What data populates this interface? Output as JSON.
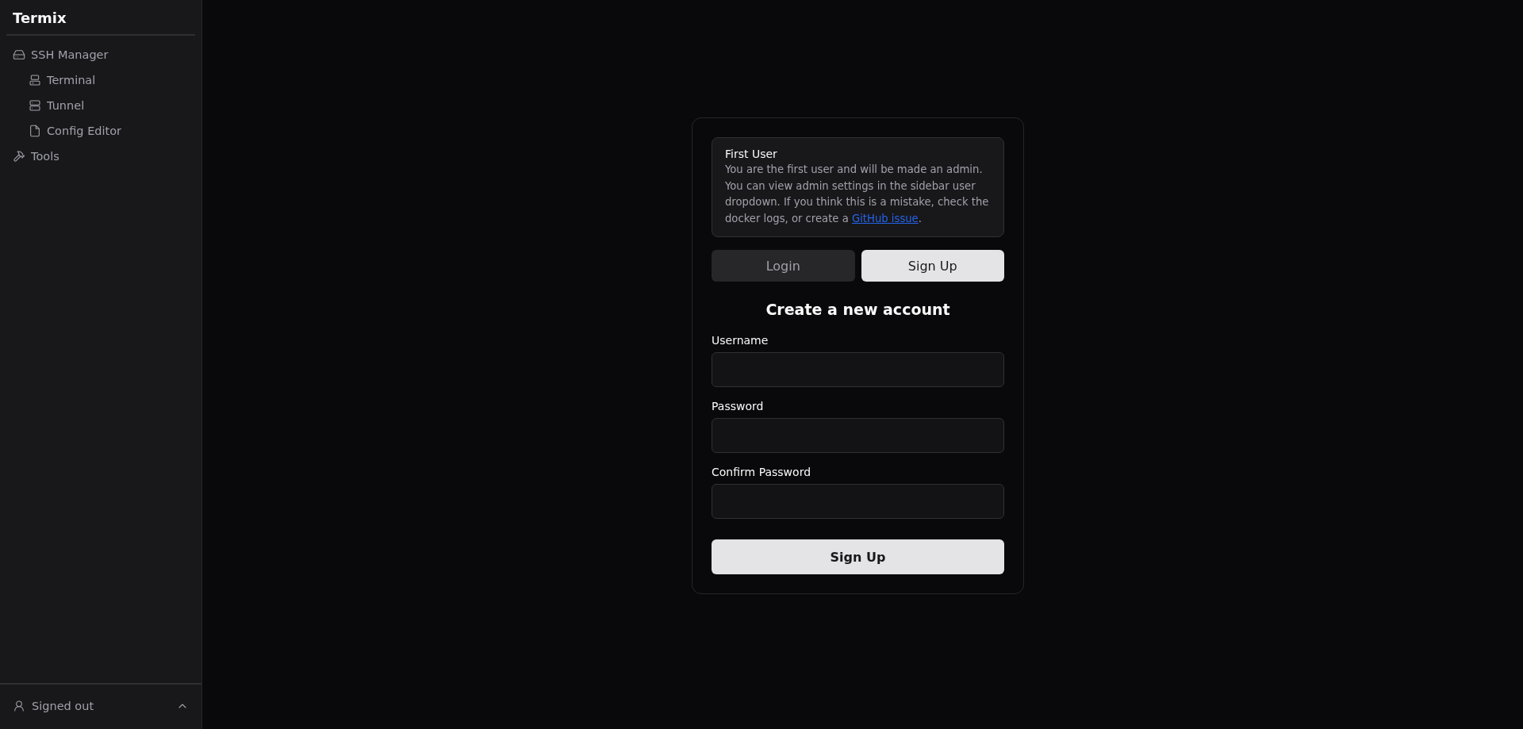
{
  "sidebar": {
    "title": "Termix",
    "items": [
      {
        "label": "SSH Manager",
        "children": [
          {
            "label": "Terminal"
          },
          {
            "label": "Tunnel"
          },
          {
            "label": "Config Editor"
          }
        ]
      },
      {
        "label": "Tools"
      }
    ],
    "footer": {
      "label": "Signed out",
      "expanded": false
    }
  },
  "auth_card": {
    "alert": {
      "title": "First User",
      "text": "You are the first user and will be made an admin. You can view admin settings in the sidebar user dropdown. If you think this is a mistake, check the docker logs, or create a ",
      "link": "GitHub issue",
      "text_end": "."
    },
    "tabs": [
      {
        "label": "Login",
        "selected": false
      },
      {
        "label": "Sign Up",
        "selected": true
      }
    ],
    "heading": "Create a new account",
    "fields": [
      {
        "label": "Username"
      },
      {
        "label": "Password"
      },
      {
        "label": "Confirm Password"
      }
    ],
    "submit": "Sign Up"
  }
}
